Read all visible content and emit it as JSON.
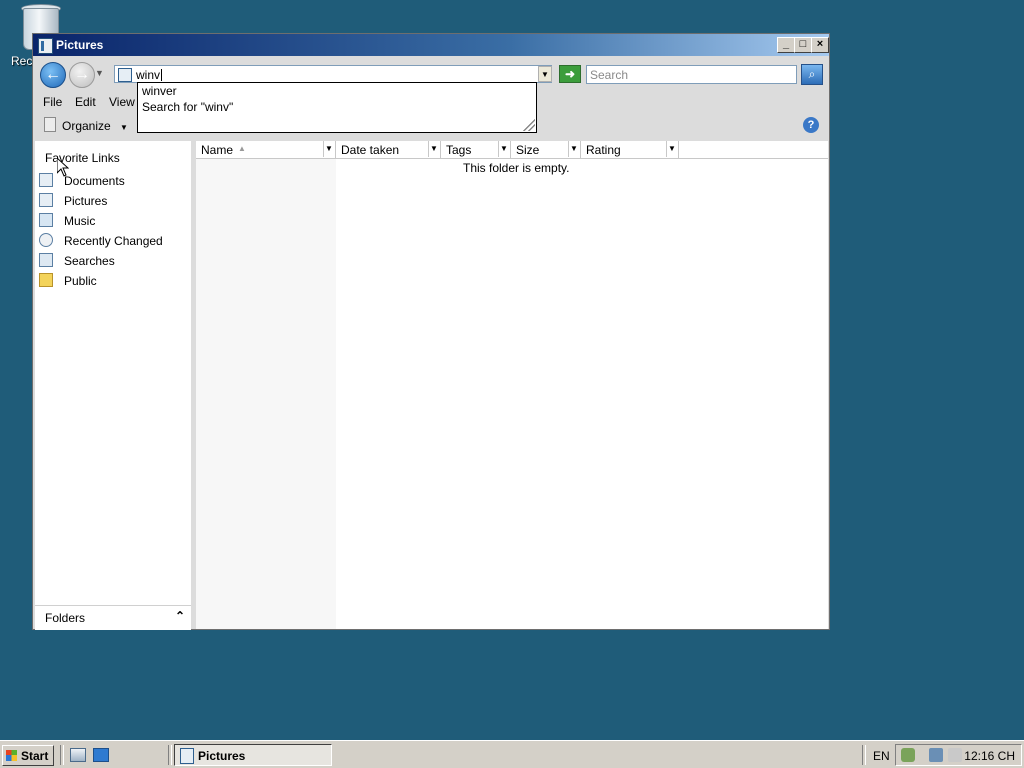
{
  "desktop": {
    "recycle_label": "Rec"
  },
  "window": {
    "title": "Pictures",
    "controls": {
      "minimize": "_",
      "maximize": "□",
      "close": "×"
    }
  },
  "address": {
    "value": "winv",
    "search_placeholder": "Search"
  },
  "autocomplete": {
    "items": [
      "winver",
      "Search for \"winv\""
    ]
  },
  "menu": {
    "items": [
      "File",
      "Edit",
      "View"
    ]
  },
  "toolbar": {
    "organize_label": "Organize",
    "organize_arrow": "▼",
    "help": "?"
  },
  "favorites": {
    "title": "Favorite Links",
    "items": [
      "Documents",
      "Pictures",
      "Music",
      "Recently Changed",
      "Searches",
      "Public"
    ]
  },
  "folders": {
    "label": "Folders",
    "chevron": "⌃"
  },
  "columns": [
    "Name",
    "Date taken",
    "Tags",
    "Size",
    "Rating"
  ],
  "content": {
    "empty_message": "This folder is empty."
  },
  "taskbar": {
    "start_label": "Start",
    "task_button": "Pictures",
    "language": "EN",
    "clock": "12:16 CH"
  },
  "colors": {
    "desktop": "#1f5c79",
    "titlebar_start": "#0a246a",
    "titlebar_end": "#a6caf0",
    "taskbar": "#d4d0c8"
  }
}
